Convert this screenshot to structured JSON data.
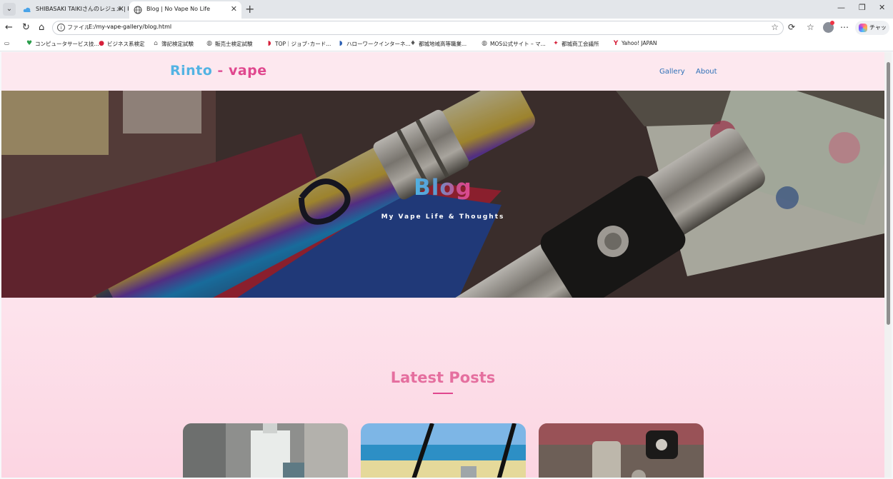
{
  "browser": {
    "tabs": [
      {
        "title": "SHIBASAKI TAIKIさんのレジュメ | RESU",
        "active": false
      },
      {
        "title": "Blog | No Vape No Life",
        "active": true
      }
    ],
    "address": {
      "scheme_label": "ファイル",
      "url": "E:/my-vape-gallery/blog.html"
    },
    "chat_label": "チャット",
    "bookmarks": [
      "コンピュータサービス技...",
      "ビジネス系検定",
      "簿記検定試験",
      "販売士検定試験",
      "TOP｜ジョブ･カード...",
      "ハローワークインターネ...",
      "都城地域高等職業...",
      "MOS公式サイト – マ...",
      "都城商工会議所",
      "Yahoo! JAPAN"
    ]
  },
  "site": {
    "brand": {
      "part1": "Rinto",
      "separator": " - ",
      "part2": "vape"
    },
    "nav": [
      {
        "label": "Gallery"
      },
      {
        "label": "About"
      }
    ],
    "hero": {
      "title": "Blog",
      "subtitle": "My Vape Life & Thoughts"
    },
    "section_title": "Latest Posts",
    "cards": [
      {
        "theme": "bottle-on-wood"
      },
      {
        "theme": "beach-sea"
      },
      {
        "theme": "vape-parts"
      }
    ]
  },
  "colors": {
    "brand_blue": "#53b3e3",
    "brand_pink": "#e0478e",
    "section_title": "#e56f9f",
    "nav_link": "#2d6fb7",
    "page_bg": "#fde8ef"
  }
}
